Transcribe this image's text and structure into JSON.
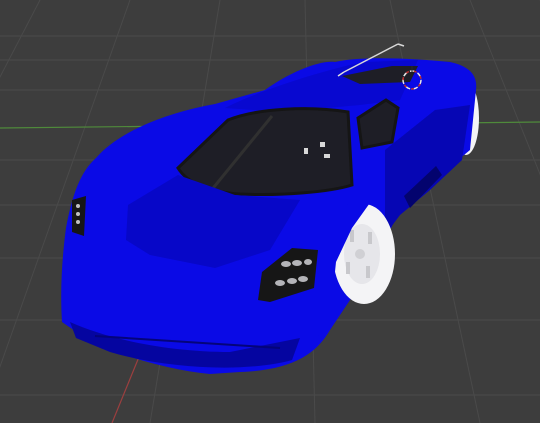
{
  "viewport": {
    "background_color": "#3d3d3d",
    "grid_color": "#4a4a4a",
    "x_axis_color": "#9c3f3f",
    "y_axis_color": "#4f8a3b"
  },
  "model": {
    "name": "blue supercar",
    "body_color": "#0a0ae6",
    "body_shade_color": "#0606b4",
    "glass_color": "#1e1e26",
    "trim_color": "#151515",
    "wheel_color": "#f4f4f6"
  },
  "icons": {
    "light_gizmo": "sun-lamp-icon",
    "origin_marker": "origin-circle-icon"
  }
}
